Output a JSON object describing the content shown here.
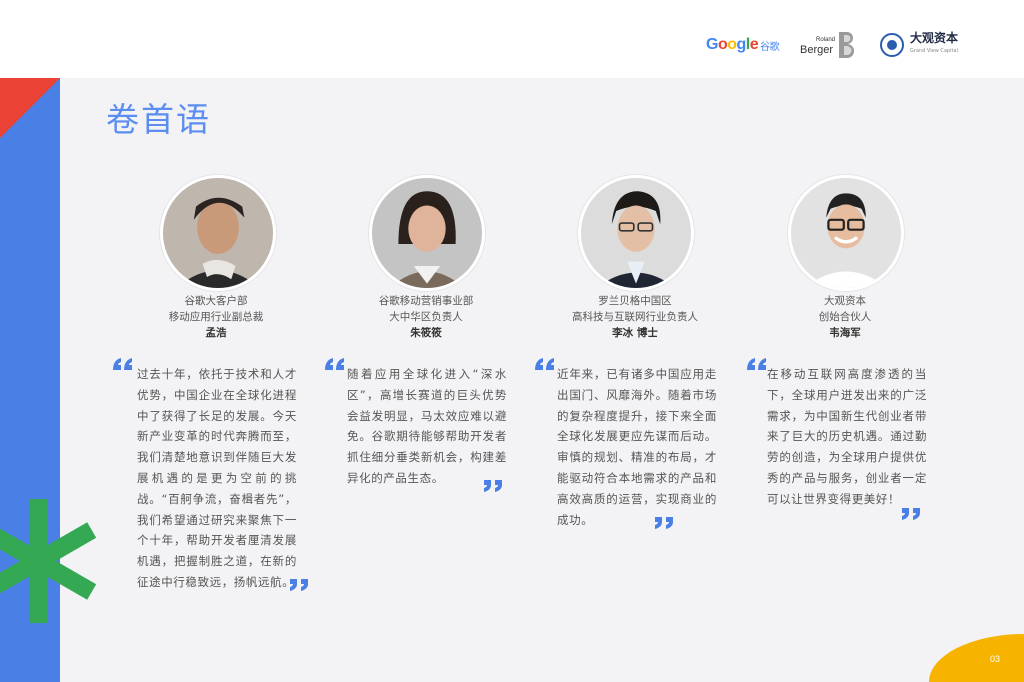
{
  "header": {
    "google_logo": "Google",
    "google_logo_cn": "谷歌",
    "rb_logo_small": "Roland",
    "rb_logo": "Berger",
    "dg_logo": "大观资本",
    "dg_logo_sub": "Grand View Capital"
  },
  "title": "卷首语",
  "page_number": "03",
  "colors": {
    "blue": "#4a7fe5",
    "red": "#ea4335",
    "green": "#34a853",
    "yellow": "#f6b400",
    "title_blue": "#5b8ef0"
  },
  "people": [
    {
      "line1": "谷歌大客户部",
      "line2": "移动应用行业副总裁",
      "name": "孟浩",
      "quote": "过去十年，依托于技术和人才优势，中国企业在全球化进程中了获得了长足的发展。今天新产业变革的时代奔腾而至，我们清楚地意识到伴随巨大发展机遇的是更为空前的挑战。“百舸争流，奋楫者先”，我们希望通过研究来聚焦下一个十年，帮助开发者厘清发展机遇，把握制胜之道，在新的征途中行稳致远，扬帆远航。"
    },
    {
      "line1": "谷歌移动营销事业部",
      "line2": "大中华区负责人",
      "name": "朱筱筱",
      "quote": "随着应用全球化进入“深水区”，高增长赛道的巨头优势会益发明显，马太效应难以避免。谷歌期待能够帮助开发者抓住细分垂类新机会，构建差异化的产品生态。"
    },
    {
      "line1": "罗兰贝格中国区",
      "line2": "高科技与互联网行业负责人",
      "name": "李冰 博士",
      "quote": "近年来，已有诸多中国应用走出国门、风靡海外。随着市场的复杂程度提升，接下来全面全球化发展更应先谋而后动。审慎的规划、精准的布局，才能驱动符合本地需求的产品和高效高质的运营，实现商业的成功。"
    },
    {
      "line1": "大观资本",
      "line2": "创始合伙人",
      "name": "韦海军",
      "quote": "在移动互联网高度渗透的当下，全球用户迸发出来的广泛需求，为中国新生代创业者带来了巨大的历史机遇。通过勤劳的创造，为全球用户提供优秀的产品与服务，创业者一定可以让世界变得更美好！"
    }
  ]
}
